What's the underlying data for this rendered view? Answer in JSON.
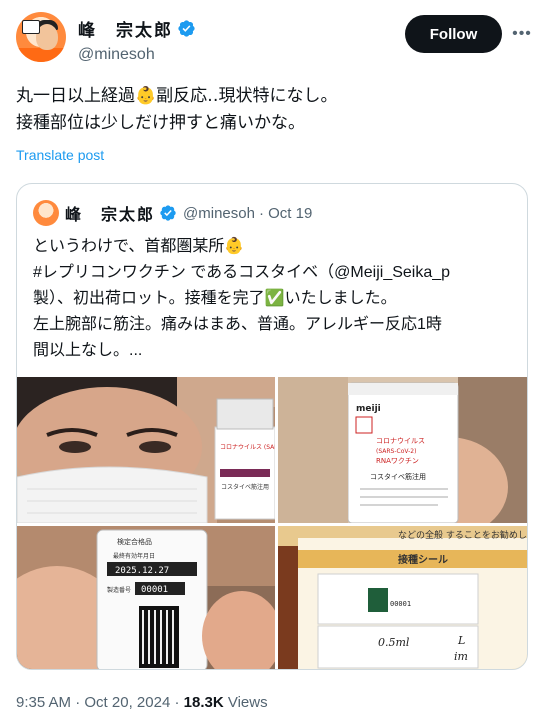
{
  "author": {
    "display_name": "峰　宗太郎",
    "handle": "@minesoh"
  },
  "follow_label": "Follow",
  "post": {
    "lines": [
      "丸一日以上経過👶副反応‥現状特になし。",
      "接種部位は少しだけ押すと痛いかな。"
    ]
  },
  "translate_label": "Translate post",
  "quoted": {
    "display_name": "峰　宗太郎",
    "handle": "@minesoh",
    "date": "· Oct 19",
    "lines": [
      "というわけで、首都圏某所👶",
      "#レプリコンワクチン であるコスタイベ（@Meiji_Seika_p",
      "製）、初出荷ロット。接種を完了✅いたしました。",
      "左上腕部に筋注。痛みはまあ、普通。アレルギー反応1時",
      "間以上なし。..."
    ],
    "photos": {
      "vial_label_1": "コロナウイルス (SARS-CoV-2) RNAワクチン",
      "vial_label_2": "コスタイベ筋注用",
      "brand": "meiji",
      "expiry": "2025.12.27",
      "lot": "00001",
      "sticker_title": "接種シール",
      "sticker_lot": "00001",
      "sticker_hand": "0.5ml",
      "notice": "などの全般 することをお勧めします。"
    }
  },
  "footer": {
    "time": "9:35 AM",
    "sep1": " · ",
    "date": "Oct 20, 2024",
    "sep2": " · ",
    "views_count": "18.3K",
    "views_label": " Views"
  },
  "colors": {
    "link": "#1d9bf0",
    "verified": "#1d9bf0",
    "text": "#0f1419",
    "muted": "#536471"
  }
}
